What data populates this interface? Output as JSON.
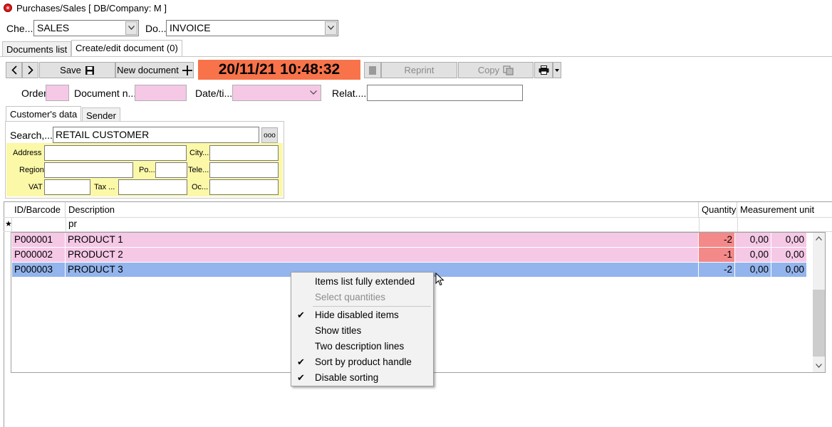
{
  "window": {
    "title": "Purchases/Sales  [ DB/Company: M ]"
  },
  "selectors": {
    "check_label": "Che...",
    "check_value": "SALES",
    "doc_label": "Do...",
    "doc_value": "INVOICE"
  },
  "tabs": [
    {
      "label": "Documents list"
    },
    {
      "label": "Create/edit document (0)"
    }
  ],
  "toolbar": {
    "save_label": "Save",
    "new_document_label": "New document",
    "clock": "20/11/21 10:48:32",
    "reprint_label": "Reprint",
    "copy_label": "Copy"
  },
  "header_fields": {
    "order_label": "Order",
    "order_value": "",
    "docnum_label": "Document n...",
    "docnum_value": "",
    "datetime_label": "Date/ti...",
    "datetime_value": "",
    "related_label": "Relat....",
    "related_value": ""
  },
  "customer_tabs": [
    {
      "label": "Customer's data"
    },
    {
      "label": "Sender"
    }
  ],
  "customer": {
    "search_label": "Search,...",
    "search_value": "RETAIL CUSTOMER",
    "lookup_button": "ooo",
    "address_label": "Address",
    "city_label": "City...",
    "region_label": "Region",
    "postal_label": "Po...",
    "phone_label": "Tele...",
    "vat_label": "VAT",
    "tax_label": "Tax ...",
    "occupation_label": "Oc..."
  },
  "grid": {
    "columns": [
      "ID/Barcode",
      "Description",
      "Quantity",
      "Measurement unit"
    ],
    "filter_marker": "★",
    "filter_description": "pr",
    "rows": [
      {
        "id": "P000001",
        "description": "PRODUCT 1",
        "quantity": "-2",
        "v1": "0,00",
        "v2": "0,00"
      },
      {
        "id": "P000002",
        "description": "PRODUCT 2",
        "quantity": "-1",
        "v1": "0,00",
        "v2": "0,00"
      },
      {
        "id": "P000003",
        "description": "PRODUCT 3",
        "quantity": "-2",
        "v1": "0,00",
        "v2": "0,00"
      }
    ]
  },
  "context_menu": {
    "items": [
      {
        "label": "Items list fully extended",
        "checked": false,
        "disabled": false
      },
      {
        "label": "Select quantities",
        "checked": false,
        "disabled": true
      },
      {
        "label": "Hide disabled items",
        "checked": true,
        "disabled": false
      },
      {
        "label": "Show titles",
        "checked": false,
        "disabled": false
      },
      {
        "label": "Two description lines",
        "checked": false,
        "disabled": false
      },
      {
        "label": "Sort by product handle",
        "checked": true,
        "disabled": false
      },
      {
        "label": "Disable sorting",
        "checked": true,
        "disabled": false
      }
    ],
    "check_glyph": "✔"
  },
  "colors": {
    "clock_bg": "#f8734a",
    "pink_row": "#f5c8e6",
    "selected_row": "#93b4ec",
    "quantity_cell": "#f4898a",
    "customer_panel": "#fbf8a8"
  }
}
